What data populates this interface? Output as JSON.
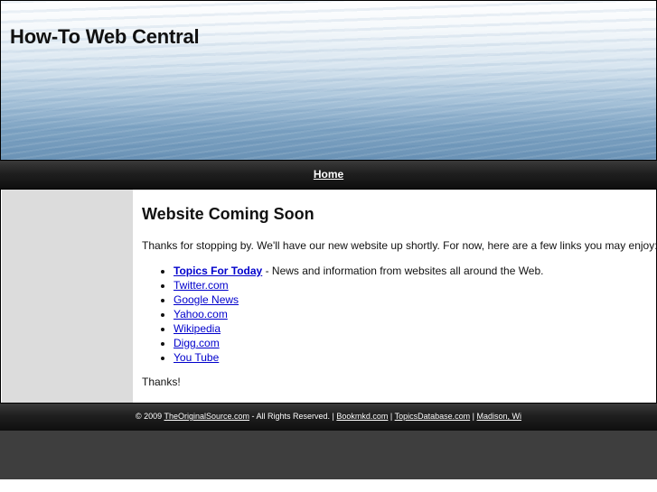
{
  "header": {
    "site_title": "How-To Web Central"
  },
  "nav": {
    "home_label": "Home"
  },
  "content": {
    "heading": "Website Coming Soon",
    "intro": "Thanks for stopping by. We'll have our new website up shortly. For now, here are a few links you may enjoy:",
    "links": [
      {
        "label": "Topics For Today",
        "suffix": " - News and information from websites all around the Web."
      },
      {
        "label": "Twitter.com"
      },
      {
        "label": "Google News"
      },
      {
        "label": "Yahoo.com"
      },
      {
        "label": "Wikipedia"
      },
      {
        "label": "Digg.com"
      },
      {
        "label": "You Tube"
      }
    ],
    "thanks": "Thanks!"
  },
  "footer": {
    "copyright_prefix": "© 2009 ",
    "source_link": "TheOriginalSource.com",
    "rights_text": " - All Rights Reserved. | ",
    "link_1": "Bookmkd.com",
    "separator": " | ",
    "link_2": "TopicsDatabase.com",
    "link_3": "Madison, Wi"
  },
  "colors": {
    "link": "#0000cc",
    "nav_bar": "#1f1f1f",
    "sidebar": "#dcdcdc"
  }
}
